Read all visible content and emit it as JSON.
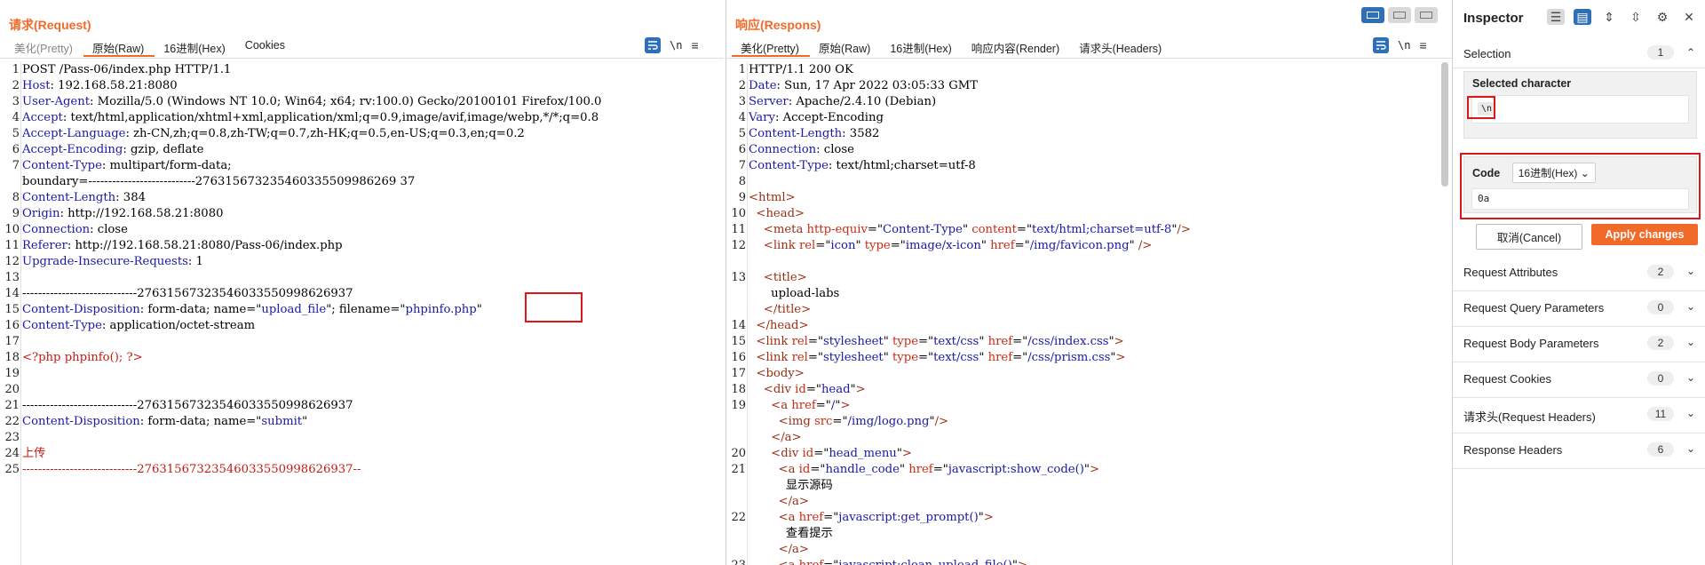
{
  "request": {
    "title": "请求(Request)",
    "tabs": [
      "美化(Pretty)",
      "原始(Raw)",
      "16进制(Hex)",
      "Cookies"
    ],
    "active_tab": 1,
    "newline_label": "\\n",
    "lines": [
      {
        "n": "1",
        "segs": [
          [
            "v",
            "POST /Pass-06/index.php HTTP/1.1"
          ]
        ]
      },
      {
        "n": "2",
        "segs": [
          [
            "k",
            "Host"
          ],
          [
            "v",
            ": 192.168.58.21:8080"
          ]
        ]
      },
      {
        "n": "3",
        "segs": [
          [
            "k",
            "User-Agent"
          ],
          [
            "v",
            ": Mozilla/5.0 (Windows NT 10.0; Win64; x64; rv:100.0) Gecko/20100101 Firefox/100.0"
          ]
        ]
      },
      {
        "n": "4",
        "segs": [
          [
            "k",
            "Accept"
          ],
          [
            "v",
            ": text/html,application/xhtml+xml,application/xml;q=0.9,image/avif,image/webp,*/*;q=0.8"
          ]
        ]
      },
      {
        "n": "5",
        "segs": [
          [
            "k",
            "Accept-Language"
          ],
          [
            "v",
            ": zh-CN,zh;q=0.8,zh-TW;q=0.7,zh-HK;q=0.5,en-US;q=0.3,en;q=0.2"
          ]
        ]
      },
      {
        "n": "6",
        "segs": [
          [
            "k",
            "Accept-Encoding"
          ],
          [
            "v",
            ": gzip, deflate"
          ]
        ]
      },
      {
        "n": "7",
        "segs": [
          [
            "k",
            "Content-Type"
          ],
          [
            "v",
            ": multipart/form-data;"
          ]
        ]
      },
      {
        "n": "",
        "segs": [
          [
            "v",
            "boundary=---------------------------276315673235460335509986269 37"
          ]
        ]
      },
      {
        "n": "8",
        "segs": [
          [
            "k",
            "Content-Length"
          ],
          [
            "v",
            ": 384"
          ]
        ]
      },
      {
        "n": "9",
        "segs": [
          [
            "k",
            "Origin"
          ],
          [
            "v",
            ": http://192.168.58.21:8080"
          ]
        ]
      },
      {
        "n": "10",
        "segs": [
          [
            "k",
            "Connection"
          ],
          [
            "v",
            ": close"
          ]
        ]
      },
      {
        "n": "11",
        "segs": [
          [
            "k",
            "Referer"
          ],
          [
            "v",
            ": http://192.168.58.21:8080/Pass-06/index.php"
          ]
        ]
      },
      {
        "n": "12",
        "segs": [
          [
            "k",
            "Upgrade-Insecure-Requests"
          ],
          [
            "v",
            ": 1"
          ]
        ]
      },
      {
        "n": "13",
        "segs": []
      },
      {
        "n": "14",
        "segs": [
          [
            "v",
            "-----------------------------27631567323546033550998626937"
          ]
        ]
      },
      {
        "n": "15",
        "segs": [
          [
            "k",
            "Content-Disposition"
          ],
          [
            "v",
            ": form-data; name=\""
          ],
          [
            "s",
            "upload_file"
          ],
          [
            "v",
            "\"; filename=\""
          ],
          [
            "s",
            "phpinfo.php"
          ],
          [
            "v",
            "\""
          ]
        ]
      },
      {
        "n": "16",
        "segs": [
          [
            "k",
            "Content-Type"
          ],
          [
            "v",
            ": application/octet-stream"
          ]
        ]
      },
      {
        "n": "17",
        "segs": []
      },
      {
        "n": "18",
        "segs": [
          [
            "php",
            "<?php phpinfo(); ?>"
          ]
        ]
      },
      {
        "n": "19",
        "segs": []
      },
      {
        "n": "20",
        "segs": []
      },
      {
        "n": "21",
        "segs": [
          [
            "v",
            "-----------------------------27631567323546033550998626937"
          ]
        ]
      },
      {
        "n": "22",
        "segs": [
          [
            "k",
            "Content-Disposition"
          ],
          [
            "v",
            ": form-data; name=\""
          ],
          [
            "s",
            "submit"
          ],
          [
            "v",
            "\""
          ]
        ]
      },
      {
        "n": "23",
        "segs": []
      },
      {
        "n": "24",
        "segs": [
          [
            "php",
            "上传"
          ]
        ]
      },
      {
        "n": "25",
        "segs": [
          [
            "php",
            "-----------------------------27631567323546033550998626937--"
          ]
        ]
      }
    ]
  },
  "response": {
    "title": "响应(Respons)",
    "tabs": [
      "美化(Pretty)",
      "原始(Raw)",
      "16进制(Hex)",
      "响应内容(Render)",
      "请求头(Headers)"
    ],
    "active_tab": 0,
    "newline_label": "\\n",
    "lines": [
      {
        "n": "1",
        "segs": [
          [
            "v",
            "HTTP/1.1 200 OK"
          ]
        ]
      },
      {
        "n": "2",
        "segs": [
          [
            "k",
            "Date"
          ],
          [
            "v",
            ": Sun, 17 Apr 2022 03:05:33 GMT"
          ]
        ]
      },
      {
        "n": "3",
        "segs": [
          [
            "k",
            "Server"
          ],
          [
            "v",
            ": Apache/2.4.10 (Debian)"
          ]
        ]
      },
      {
        "n": "4",
        "segs": [
          [
            "k",
            "Vary"
          ],
          [
            "v",
            ": Accept-Encoding"
          ]
        ]
      },
      {
        "n": "5",
        "segs": [
          [
            "k",
            "Content-Length"
          ],
          [
            "v",
            ": 3582"
          ]
        ]
      },
      {
        "n": "6",
        "segs": [
          [
            "k",
            "Connection"
          ],
          [
            "v",
            ": close"
          ]
        ]
      },
      {
        "n": "7",
        "segs": [
          [
            "k",
            "Content-Type"
          ],
          [
            "v",
            ": text/html;charset=utf-8"
          ]
        ]
      },
      {
        "n": "8",
        "segs": []
      },
      {
        "n": "9",
        "segs": [
          [
            "t",
            "<html>"
          ]
        ]
      },
      {
        "n": "10",
        "segs": [
          [
            "v",
            "  "
          ],
          [
            "t",
            "<head>"
          ]
        ]
      },
      {
        "n": "11",
        "segs": [
          [
            "v",
            "    "
          ],
          [
            "t",
            "<meta "
          ],
          [
            "a",
            "http-equiv"
          ],
          [
            "v",
            "=\""
          ],
          [
            "s",
            "Content-Type"
          ],
          [
            "v",
            "\" "
          ],
          [
            "a",
            "content"
          ],
          [
            "v",
            "=\""
          ],
          [
            "s",
            "text/html;charset=utf-8"
          ],
          [
            "v",
            "\""
          ],
          [
            "t",
            "/>"
          ]
        ]
      },
      {
        "n": "12",
        "segs": [
          [
            "v",
            "    "
          ],
          [
            "t",
            "<link "
          ],
          [
            "a",
            "rel"
          ],
          [
            "v",
            "=\""
          ],
          [
            "s",
            "icon"
          ],
          [
            "v",
            "\" "
          ],
          [
            "a",
            "type"
          ],
          [
            "v",
            "=\""
          ],
          [
            "s",
            "image/x-icon"
          ],
          [
            "v",
            "\" "
          ],
          [
            "a",
            "href"
          ],
          [
            "v",
            "=\""
          ],
          [
            "s",
            "/img/favicon.png"
          ],
          [
            "v",
            "\" "
          ],
          [
            "t",
            "/>"
          ]
        ]
      },
      {
        "n": "",
        "segs": []
      },
      {
        "n": "13",
        "segs": [
          [
            "v",
            "    "
          ],
          [
            "t",
            "<title>"
          ]
        ]
      },
      {
        "n": "",
        "segs": [
          [
            "v",
            "      upload-labs"
          ]
        ]
      },
      {
        "n": "",
        "segs": [
          [
            "v",
            "    "
          ],
          [
            "t",
            "</title>"
          ]
        ]
      },
      {
        "n": "14",
        "segs": [
          [
            "v",
            "  "
          ],
          [
            "t",
            "</head>"
          ]
        ]
      },
      {
        "n": "15",
        "segs": [
          [
            "v",
            "  "
          ],
          [
            "t",
            "<link "
          ],
          [
            "a",
            "rel"
          ],
          [
            "v",
            "=\""
          ],
          [
            "s",
            "stylesheet"
          ],
          [
            "v",
            "\" "
          ],
          [
            "a",
            "type"
          ],
          [
            "v",
            "=\""
          ],
          [
            "s",
            "text/css"
          ],
          [
            "v",
            "\" "
          ],
          [
            "a",
            "href"
          ],
          [
            "v",
            "=\""
          ],
          [
            "s",
            "/css/index.css"
          ],
          [
            "v",
            "\""
          ],
          [
            "t",
            ">"
          ]
        ]
      },
      {
        "n": "16",
        "segs": [
          [
            "v",
            "  "
          ],
          [
            "t",
            "<link "
          ],
          [
            "a",
            "rel"
          ],
          [
            "v",
            "=\""
          ],
          [
            "s",
            "stylesheet"
          ],
          [
            "v",
            "\" "
          ],
          [
            "a",
            "type"
          ],
          [
            "v",
            "=\""
          ],
          [
            "s",
            "text/css"
          ],
          [
            "v",
            "\" "
          ],
          [
            "a",
            "href"
          ],
          [
            "v",
            "=\""
          ],
          [
            "s",
            "/css/prism.css"
          ],
          [
            "v",
            "\""
          ],
          [
            "t",
            ">"
          ]
        ]
      },
      {
        "n": "17",
        "segs": [
          [
            "v",
            "  "
          ],
          [
            "t",
            "<body>"
          ]
        ]
      },
      {
        "n": "18",
        "segs": [
          [
            "v",
            "    "
          ],
          [
            "t",
            "<div "
          ],
          [
            "a",
            "id"
          ],
          [
            "v",
            "=\""
          ],
          [
            "s",
            "head"
          ],
          [
            "v",
            "\""
          ],
          [
            "t",
            ">"
          ]
        ]
      },
      {
        "n": "19",
        "segs": [
          [
            "v",
            "      "
          ],
          [
            "t",
            "<a "
          ],
          [
            "a",
            "href"
          ],
          [
            "v",
            "=\""
          ],
          [
            "s",
            "/"
          ],
          [
            "v",
            "\""
          ],
          [
            "t",
            ">"
          ]
        ]
      },
      {
        "n": "",
        "segs": [
          [
            "v",
            "        "
          ],
          [
            "t",
            "<img "
          ],
          [
            "a",
            "src"
          ],
          [
            "v",
            "=\""
          ],
          [
            "s",
            "/img/logo.png"
          ],
          [
            "v",
            "\""
          ],
          [
            "t",
            "/>"
          ]
        ]
      },
      {
        "n": "",
        "segs": [
          [
            "v",
            "      "
          ],
          [
            "t",
            "</a>"
          ]
        ]
      },
      {
        "n": "20",
        "segs": [
          [
            "v",
            "      "
          ],
          [
            "t",
            "<div "
          ],
          [
            "a",
            "id"
          ],
          [
            "v",
            "=\""
          ],
          [
            "s",
            "head_menu"
          ],
          [
            "v",
            "\""
          ],
          [
            "t",
            ">"
          ]
        ]
      },
      {
        "n": "21",
        "segs": [
          [
            "v",
            "        "
          ],
          [
            "t",
            "<a "
          ],
          [
            "a",
            "id"
          ],
          [
            "v",
            "=\""
          ],
          [
            "s",
            "handle_code"
          ],
          [
            "v",
            "\" "
          ],
          [
            "a",
            "href"
          ],
          [
            "v",
            "=\""
          ],
          [
            "s",
            "javascript:show_code()"
          ],
          [
            "v",
            "\""
          ],
          [
            "t",
            ">"
          ]
        ]
      },
      {
        "n": "",
        "segs": [
          [
            "v",
            "          显示源码"
          ]
        ]
      },
      {
        "n": "",
        "segs": [
          [
            "v",
            "        "
          ],
          [
            "t",
            "</a>"
          ]
        ]
      },
      {
        "n": "22",
        "segs": [
          [
            "v",
            "        "
          ],
          [
            "t",
            "<a "
          ],
          [
            "a",
            "href"
          ],
          [
            "v",
            "=\""
          ],
          [
            "s",
            "javascript:get_prompt()"
          ],
          [
            "v",
            "\""
          ],
          [
            "t",
            ">"
          ]
        ]
      },
      {
        "n": "",
        "segs": [
          [
            "v",
            "          查看提示"
          ]
        ]
      },
      {
        "n": "",
        "segs": [
          [
            "v",
            "        "
          ],
          [
            "t",
            "</a>"
          ]
        ]
      },
      {
        "n": "23",
        "segs": [
          [
            "v",
            "        "
          ],
          [
            "t",
            "<a "
          ],
          [
            "a",
            "href"
          ],
          [
            "v",
            "=\""
          ],
          [
            "s",
            "javascript:clean_upload_file()"
          ],
          [
            "v",
            "\""
          ],
          [
            "t",
            ">"
          ]
        ]
      }
    ]
  },
  "inspector": {
    "title": "Inspector",
    "selection": {
      "label": "Selection",
      "count": "1"
    },
    "selected_character": {
      "label": "Selected character",
      "value": "\\n"
    },
    "code": {
      "label": "Code",
      "format": "16进制(Hex)",
      "value": "0a"
    },
    "buttons": {
      "cancel": "取消(Cancel)",
      "apply": "Apply changes"
    },
    "sections": [
      {
        "label": "Request Attributes",
        "count": "2"
      },
      {
        "label": "Request Query Parameters",
        "count": "0"
      },
      {
        "label": "Request Body Parameters",
        "count": "2"
      },
      {
        "label": "Request Cookies",
        "count": "0"
      },
      {
        "label": "请求头(Request Headers)",
        "count": "11"
      },
      {
        "label": "Response Headers",
        "count": "6"
      }
    ]
  }
}
